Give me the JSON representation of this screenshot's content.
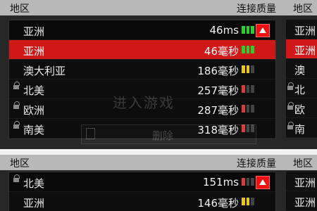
{
  "top_panel": {
    "header_left": "地区",
    "header_right": "连接质量",
    "rows": [
      {
        "name": "亚洲",
        "ping": "46ms",
        "bars": "green",
        "locked": false,
        "state": "current"
      },
      {
        "name": "亚洲",
        "ping": "46毫秒",
        "bars": "green",
        "locked": false,
        "state": "selected"
      },
      {
        "name": "澳大利亚",
        "ping": "186毫秒",
        "bars": "yellow",
        "locked": false,
        "state": "normal"
      },
      {
        "name": "北美",
        "ping": "257毫秒",
        "bars": "red",
        "locked": true,
        "state": "normal"
      },
      {
        "name": "欧洲",
        "ping": "287毫秒",
        "bars": "red",
        "locked": true,
        "state": "normal"
      },
      {
        "name": "南美",
        "ping": "318毫秒",
        "bars": "red",
        "locked": true,
        "state": "normal"
      }
    ],
    "ghost_join_label": "进入游戏",
    "ghost_delete_label": "删除"
  },
  "bottom_panel": {
    "header_left": "地区",
    "header_right": "连接质量",
    "rows": [
      {
        "name": "北美",
        "ping": "151ms",
        "bars": "red",
        "locked": true,
        "state": "current"
      },
      {
        "name": "亚洲",
        "ping": "146毫秒",
        "bars": "yellow",
        "locked": false,
        "state": "normal"
      }
    ]
  },
  "right_top_panel": {
    "header": "地区",
    "rows": [
      {
        "name": "亚洲",
        "locked": false,
        "state": "normal"
      },
      {
        "name": "亚洲",
        "locked": false,
        "state": "selected"
      },
      {
        "name": "澳",
        "locked": false,
        "state": "normal"
      },
      {
        "name": "北",
        "locked": true,
        "state": "normal"
      },
      {
        "name": "欧",
        "locked": true,
        "state": "normal"
      },
      {
        "name": "南",
        "locked": true,
        "state": "normal"
      }
    ]
  },
  "right_bottom_panel": {
    "header": "地区",
    "rows": [
      {
        "name": "亚洲",
        "locked": false,
        "state": "normal"
      },
      {
        "name": "亚洲",
        "locked": false,
        "state": "normal"
      }
    ]
  },
  "colors": {
    "selected_red": "#d01818",
    "toggle_red": "#e11111",
    "good_green": "#2ad12a",
    "mid_yellow": "#e8c81f",
    "bad_red": "#d93a3a"
  }
}
